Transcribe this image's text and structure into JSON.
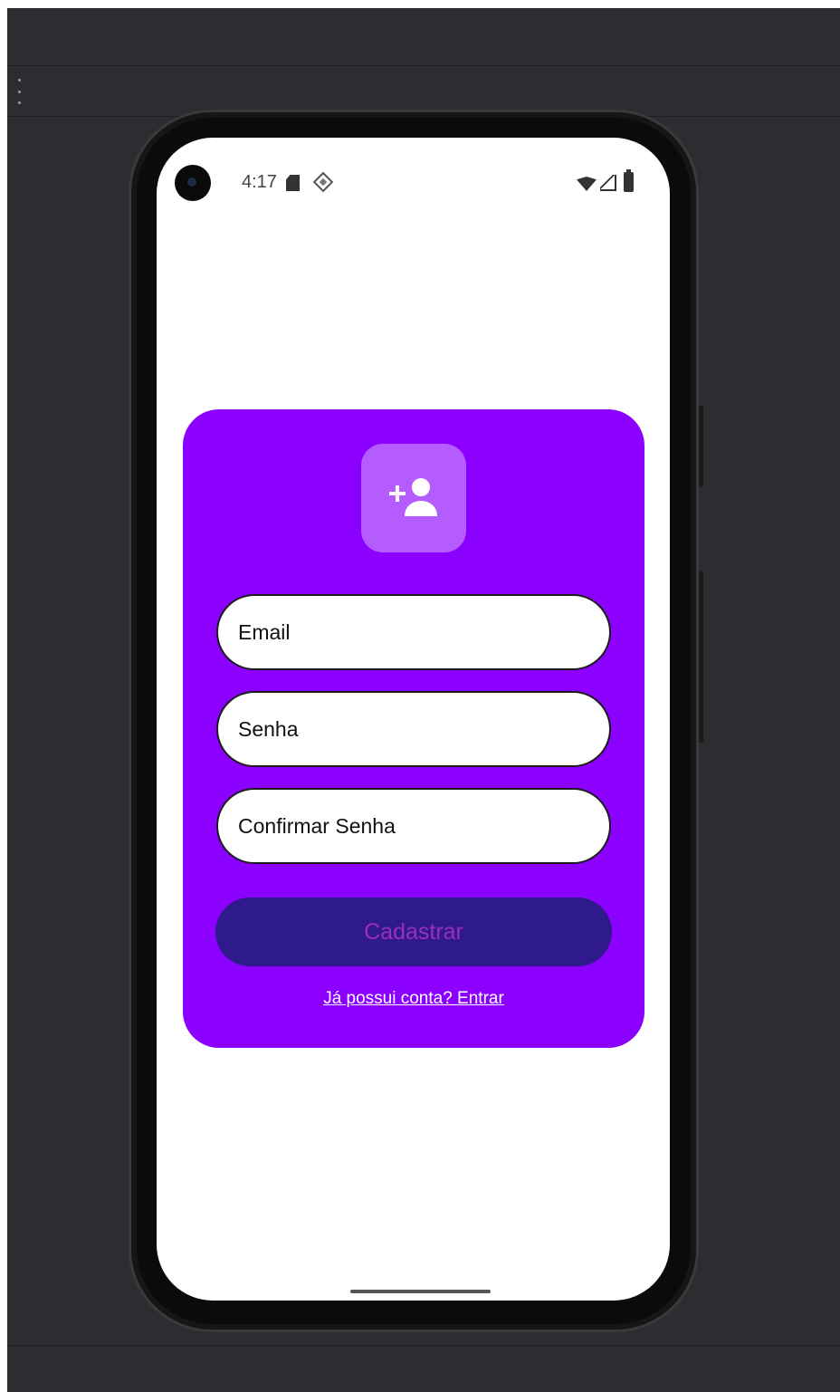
{
  "status_bar": {
    "time": "4:17"
  },
  "icons": {
    "menu": "more-vertical-icon",
    "camera": "front-camera",
    "sd_card": "sd-card-icon",
    "nfc": "nfc-icon",
    "wifi": "wifi-icon",
    "cellular": "cellular-signal-icon",
    "battery": "battery-icon",
    "avatar": "person-add-icon"
  },
  "form": {
    "email_placeholder": "Email",
    "password_placeholder": "Senha",
    "confirm_password_placeholder": "Confirmar Senha",
    "submit_label": "Cadastrar",
    "login_link": "Já possui conta? Entrar"
  },
  "colors": {
    "card_background": "#8c00ff",
    "avatar_background": "#b55cff",
    "button_background": "#2e1a8a",
    "button_text": "#9b2fb9",
    "emulator_background": "#2b2d30"
  }
}
